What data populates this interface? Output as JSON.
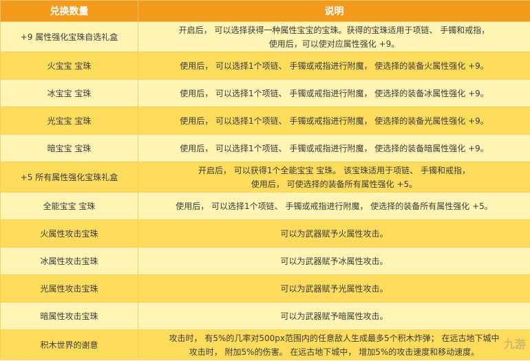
{
  "table": {
    "headers": [
      "兑换数量",
      "说明"
    ],
    "rows": [
      {
        "name": "+9 属性强化宝珠自选礼盒",
        "desc": [
          "开启后， 可以选择获得一种属性宝宝的宝珠。获得的宝珠适用于项链、 手镯和戒指，",
          "使用后，可以使对应属性强化 +9。"
        ]
      },
      {
        "name": "火宝宝 宝珠",
        "desc": [
          "使用后， 可以选择1个项链、 手镯或戒指进行附魔， 使选择的装备火属性强化 +9。"
        ]
      },
      {
        "name": "冰宝宝 宝珠",
        "desc": [
          "使用后， 可以选择1个项链、 手镯或戒指进行附魔， 使选择的装备冰属性强化 +9。"
        ]
      },
      {
        "name": "光宝宝 宝珠",
        "desc": [
          "使用后， 可以选择1个项链、 手镯或戒指进行附魔， 使选择的装备光属性强化 +9。"
        ]
      },
      {
        "name": "暗宝宝 宝珠",
        "desc": [
          "使用后， 可以选择1个项链、 手镯或戒指进行附魔， 使选择的装备暗属性强化 +9。"
        ]
      },
      {
        "name": "+5 所有属性强化宝珠礼盒",
        "desc": [
          "开启后， 可以获得1个全能宝宝 宝珠。 该宝珠适用于项链、 手镯和戒指，",
          "使用后， 可使选择的装备所有属性强化 +5。"
        ]
      },
      {
        "name": "全能宝宝 宝珠",
        "desc": [
          "使用后， 可以选择1个项链、 手镯或戒指进行附魔， 使选择的装备所有属性强化 +5。"
        ]
      },
      {
        "name": "火属性攻击宝珠",
        "desc": [
          "可以为武器赋予火属性攻击。"
        ]
      },
      {
        "name": "冰属性攻击宝珠",
        "desc": [
          "可以为武器赋予冰属性攻击。"
        ]
      },
      {
        "name": "光属性攻击宝珠",
        "desc": [
          "可以为武器赋予光属性攻击。"
        ]
      },
      {
        "name": "暗属性攻击宝珠",
        "desc": [
          "可以为武器赋予暗属性攻击。"
        ]
      },
      {
        "name": "积木世界的谢意",
        "desc": [
          "攻击时， 有5%的几率对500px范围内的任意敌人生成最多5个积木炸弹； 在远古地下城中",
          "攻击时， 附加5%的伤害。 在远古地下城中， 增加5%的攻击速度和移动速度。"
        ]
      }
    ]
  },
  "watermark": "九游"
}
